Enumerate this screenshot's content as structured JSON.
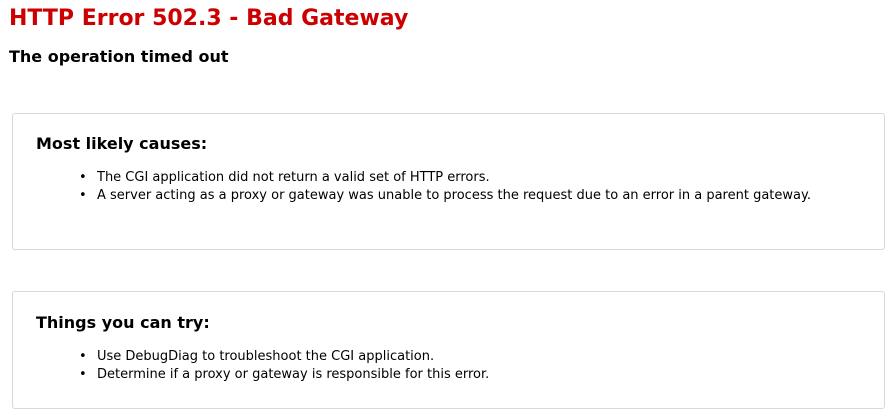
{
  "error": {
    "title": "HTTP Error 502.3 - Bad Gateway",
    "subtitle": "The operation timed out",
    "title_color": "#cc0000"
  },
  "causes": {
    "heading": "Most likely causes:",
    "items": [
      "The CGI application did not return a valid set of HTTP errors.",
      "A server acting as a proxy or gateway was unable to process the request due to an error in a parent gateway."
    ]
  },
  "try": {
    "heading": "Things you can try:",
    "items": [
      "Use DebugDiag to troubleshoot the CGI application.",
      "Determine if a proxy or gateway is responsible for this error."
    ]
  },
  "bullet_glyph": "•"
}
